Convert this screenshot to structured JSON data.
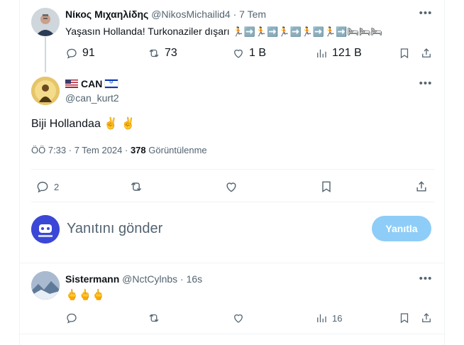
{
  "parent_tweet": {
    "display_name": "Νίκος Μιχαηλίδης",
    "handle": "@NikosMichailid4",
    "separator": "·",
    "time": "7 Tem",
    "text": "Yaşasın Hollanda! Turkonaziler dışarı",
    "emoji_sequence": "🏃➡️🏃➡️🏃➡️🏃➡️🏃➡️🛏🛏🛏",
    "replies": "91",
    "reposts": "73",
    "likes": "1 B",
    "views": "121 B"
  },
  "focused_tweet": {
    "display_name": "CAN",
    "handle": "@can_kurt2",
    "text": "Biji Hollandaa ✌️ ✌️",
    "timestamp": "ÖÖ 7:33 · 7 Tem 2024 · ",
    "view_count": "378",
    "view_label": " Görüntülenme",
    "replies": "2"
  },
  "composer": {
    "placeholder": "Yanıtını gönder",
    "reply_button": "Yanıtla"
  },
  "reply_tweet": {
    "display_name": "Sistermann",
    "handle": "@NctCylnbs",
    "separator": "·",
    "time": "16s",
    "text": "🖕🖕🖕",
    "views": "16"
  },
  "colors": {
    "text_primary": "#0f1419",
    "text_secondary": "#536471",
    "reply_button_disabled": "#8ecdf8",
    "border": "#eff3f4"
  }
}
